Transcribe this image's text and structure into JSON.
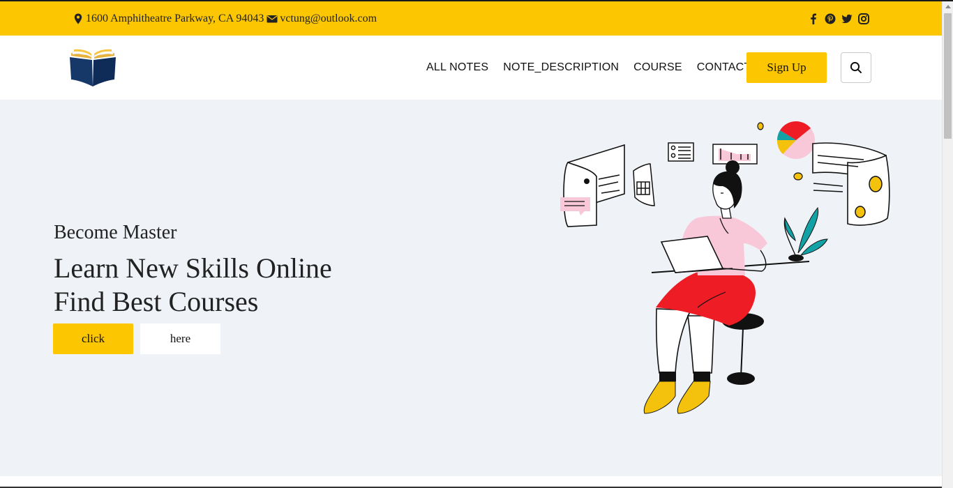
{
  "topbar": {
    "address": "1600 Amphitheatre Parkway, CA 94043",
    "email": "vctung@outlook.com",
    "social_icons": [
      "facebook-icon",
      "pinterest-icon",
      "twitter-icon",
      "instagram-icon"
    ],
    "background_color": "#fcc600"
  },
  "header": {
    "logo_icon": "open-book-logo",
    "nav": [
      "ALL NOTES",
      "NOTE_DESCRIPTION",
      "COURSE",
      "CONTACT"
    ],
    "signup_label": "Sign Up",
    "search_icon": "search-icon"
  },
  "hero": {
    "kicker": "Become Master",
    "title_line1": "Learn New Skills Online",
    "title_line2": "Find Best Courses",
    "primary_button": "click",
    "secondary_button": "here",
    "background_color": "#eff2f7",
    "illustration": "woman-studying-on-laptop-illustration"
  },
  "colors": {
    "accent": "#fcc600",
    "text": "#222222"
  }
}
